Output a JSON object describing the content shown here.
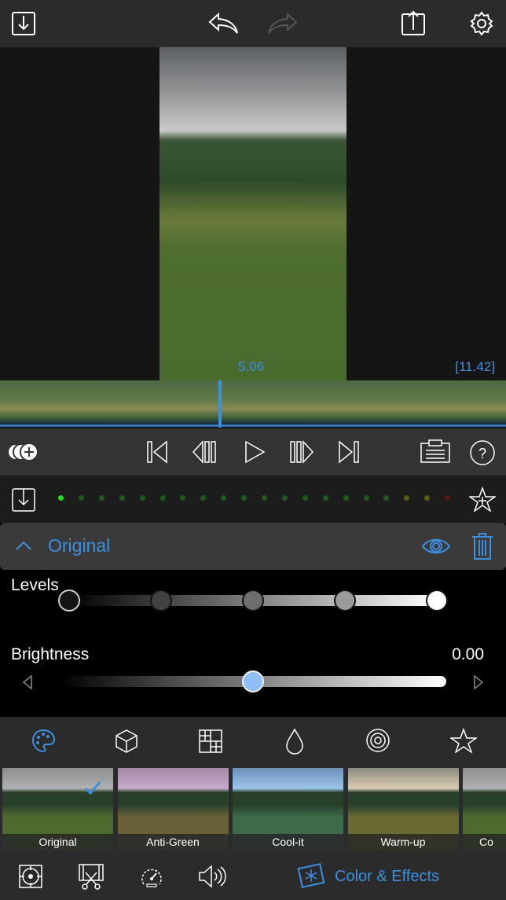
{
  "toolbar": {
    "icons": [
      "import-icon",
      "undo-icon",
      "redo-icon",
      "share-icon",
      "settings-icon"
    ]
  },
  "player": {
    "current_time": "5.06",
    "duration": "[11.42]"
  },
  "transport": {
    "icons": [
      "add-clip-icon",
      "skip-start-icon",
      "step-back-icon",
      "play-icon",
      "step-forward-icon",
      "skip-end-icon",
      "clipboard-icon",
      "help-icon"
    ]
  },
  "meter": {
    "dot_colors": [
      "#22dd22",
      "#1a5a1a",
      "#1a5a1a",
      "#1a5a1a",
      "#1a5a1a",
      "#1a5a1a",
      "#1a5a1a",
      "#1a5a1a",
      "#1a5a1a",
      "#1a5a1a",
      "#1a5a1a",
      "#1a5a1a",
      "#1a5a1a",
      "#1a5a1a",
      "#1a5a1a",
      "#1a5a1a",
      "#1a5a1a",
      "#5a5a12",
      "#5a5a12",
      "#5a1414"
    ]
  },
  "effect": {
    "title": "Original"
  },
  "levels": {
    "label": "Levels",
    "handles": [
      0,
      0.25,
      0.5,
      0.75,
      1
    ]
  },
  "brightness": {
    "label": "Brightness",
    "value": "0.00",
    "fraction": 0.5
  },
  "tabs": [
    "palette-icon",
    "cube-icon",
    "grid-pattern-icon",
    "drop-icon",
    "spiral-icon",
    "star-icon"
  ],
  "filters": [
    {
      "label": "Original",
      "selected": true
    },
    {
      "label": "Anti-Green"
    },
    {
      "label": "Cool-it"
    },
    {
      "label": "Warm-up"
    },
    {
      "label": "Co"
    }
  ],
  "bottom": {
    "active_label": "Color & Effects"
  },
  "colors": {
    "accent": "#3d8fe0"
  }
}
